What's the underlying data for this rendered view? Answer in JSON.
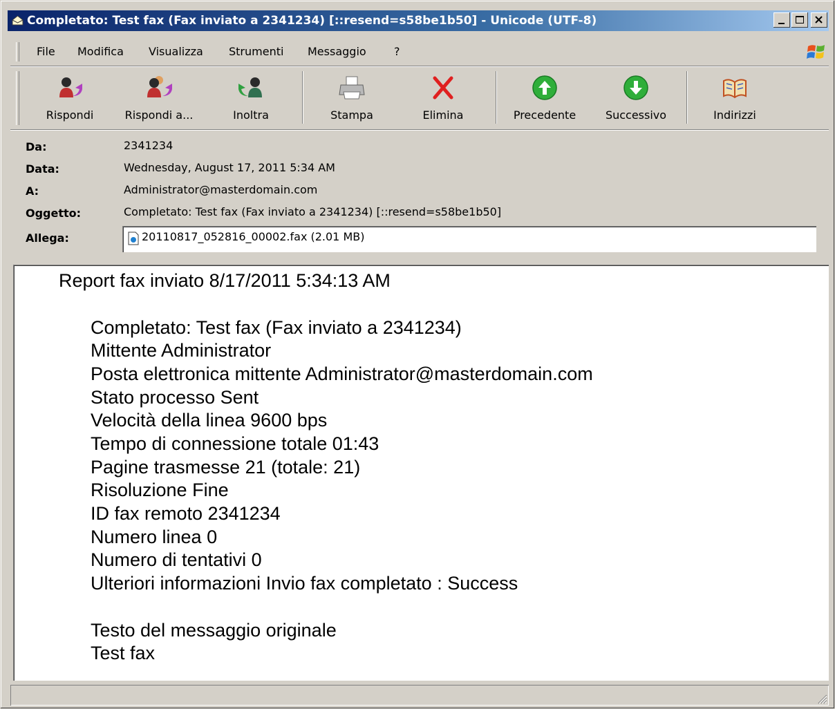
{
  "window": {
    "title": "Completato: Test fax (Fax inviato a 2341234) [::resend=s58be1b50] - Unicode (UTF-8)"
  },
  "menu": {
    "items": [
      "File",
      "Modifica",
      "Visualizza",
      "Strumenti",
      "Messaggio",
      "?"
    ]
  },
  "toolbar": {
    "reply": "Rispondi",
    "reply_all": "Rispondi a...",
    "forward": "Inoltra",
    "print": "Stampa",
    "delete": "Elimina",
    "previous": "Precedente",
    "next": "Successivo",
    "addresses": "Indirizzi"
  },
  "header": {
    "from_label": "Da:",
    "from": "2341234",
    "date_label": "Data:",
    "date": "Wednesday, August 17, 2011 5:34 AM",
    "to_label": "A:",
    "to": "Administrator@masterdomain.com",
    "subject_label": "Oggetto:",
    "subject": "Completato: Test fax (Fax inviato a 2341234) [::resend=s58be1b50]",
    "attach_label": "Allega:",
    "attachment": "20110817_052816_00002.fax (2.01 MB)"
  },
  "body": {
    "report_title": "Report fax inviato 8/17/2011 5:34:13 AM",
    "lines": [
      "Completato: Test fax (Fax inviato a 2341234)",
      "Mittente Administrator",
      "Posta elettronica mittente Administrator@masterdomain.com",
      "Stato processo Sent",
      "Velocità della linea 9600 bps",
      "Tempo di connessione totale 01:43",
      "Pagine trasmesse 21 (totale: 21)",
      "Risoluzione Fine",
      "ID fax remoto 2341234",
      "Numero linea 0",
      "Numero di tentativi 0",
      "Ulteriori informazioni Invio fax completato : Success"
    ],
    "original_label": "Testo del messaggio originale",
    "original_text": "Test fax"
  },
  "colors": {
    "titlebar_start": "#0a246a",
    "titlebar_end": "#a6caf0",
    "chrome": "#d4d0c8"
  }
}
